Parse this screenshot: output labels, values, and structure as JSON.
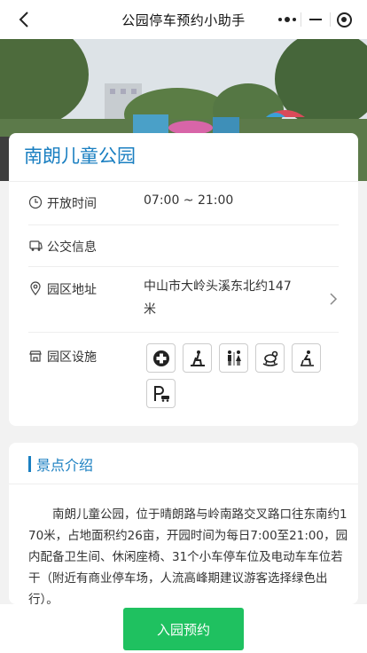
{
  "header": {
    "title": "公园停车预约小助手"
  },
  "park": {
    "name": "南朗儿童公园",
    "open_hours_label": "开放时间",
    "open_hours_value": "07:00 ~ 21:00",
    "transit_label": "公交信息",
    "address_label": "园区地址",
    "address_line1": "中山市大岭头溪东北约147",
    "address_line2": "米",
    "facilities_label": "园区设施",
    "facilities": [
      "first-aid-icon",
      "fitness-icon",
      "restroom-icon",
      "playground-icon",
      "seating-icon",
      "parking-icon"
    ]
  },
  "intro": {
    "title": "景点介绍",
    "text": "南朗儿童公园，位于晴朗路与岭南路交叉路口往东南约170米，占地面积约26亩，开园时间为每日7:00至21:00，园内配备卫生间、休闲座椅、31个小车停车位及电动车车位若干（附近有商业停车场，人流高峰期建议游客选择绿色出行）。"
  },
  "footer": {
    "reserve_label": "入园预约"
  },
  "colors": {
    "accent": "#1a7fc1",
    "button": "#1fc160"
  }
}
